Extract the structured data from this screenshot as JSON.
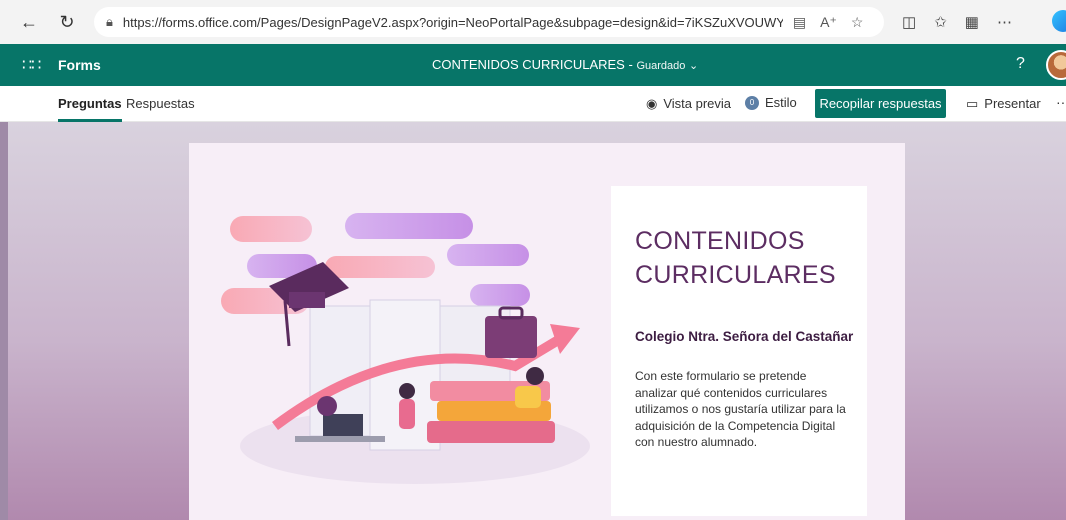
{
  "browser": {
    "url": "https://forms.office.com/Pages/DesignPageV2.aspx?origin=NeoPortalPage&subpage=design&id=7iKSZuXVOUWYfqMBWrbf...",
    "icons": [
      "back-icon",
      "reload-icon",
      "lock-icon",
      "reader-icon",
      "read-aloud-icon",
      "favorite-icon",
      "split-screen-icon",
      "favorites-list-icon",
      "collections-icon",
      "more-icon"
    ]
  },
  "header": {
    "app_name": "Forms",
    "doc_title": "CONTENIDOS CURRICULARES",
    "separator": "-",
    "saved_status": "Guardado",
    "help": "?",
    "accent_color": "#077568"
  },
  "commands": {
    "tab_questions": "Preguntas",
    "tab_responses": "Respuestas",
    "preview": "Vista previa",
    "style": "Estilo",
    "style_badge": "0",
    "collect": "Recopilar respuestas",
    "present": "Presentar",
    "more": "··"
  },
  "form": {
    "title": "CONTENIDOS CURRICULARES",
    "subtitle": "Colegio Ntra. Señora del Castañar",
    "description": "Con este formulario se pretende analizar qué contenidos curriculares utilizamos o nos gustaría utilizar para la adquisición de la Competencia Digital con nuestro alumnado."
  }
}
